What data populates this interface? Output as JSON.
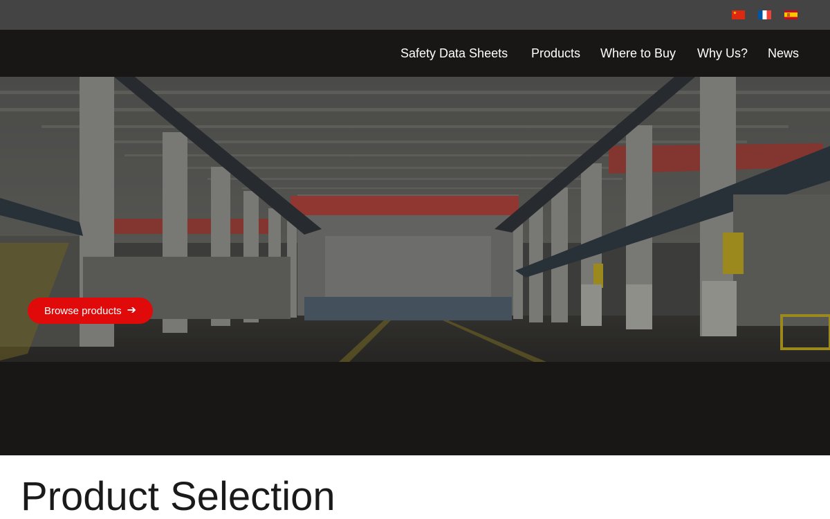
{
  "language_flags": [
    {
      "name": "Chinese",
      "icon": "flag-cn-icon"
    },
    {
      "name": "French",
      "icon": "flag-fr-icon"
    },
    {
      "name": "Spanish",
      "icon": "flag-es-icon"
    }
  ],
  "nav": {
    "items": [
      {
        "label": "Safety Data Sheets"
      },
      {
        "label": "Products"
      },
      {
        "label": "Where to Buy"
      },
      {
        "label": "Why Us?"
      },
      {
        "label": "News"
      }
    ]
  },
  "hero": {
    "image": "industrial-warehouse-interior",
    "button": {
      "label": "Browse products",
      "icon": "arrow-right-icon"
    }
  },
  "main": {
    "title": "Product Selection"
  },
  "colors": {
    "topbar": "#444444",
    "navbar": "#181716",
    "accent_button": "#e00a0a",
    "text_light": "#ffffff",
    "text_dark": "#1a1a1a"
  }
}
